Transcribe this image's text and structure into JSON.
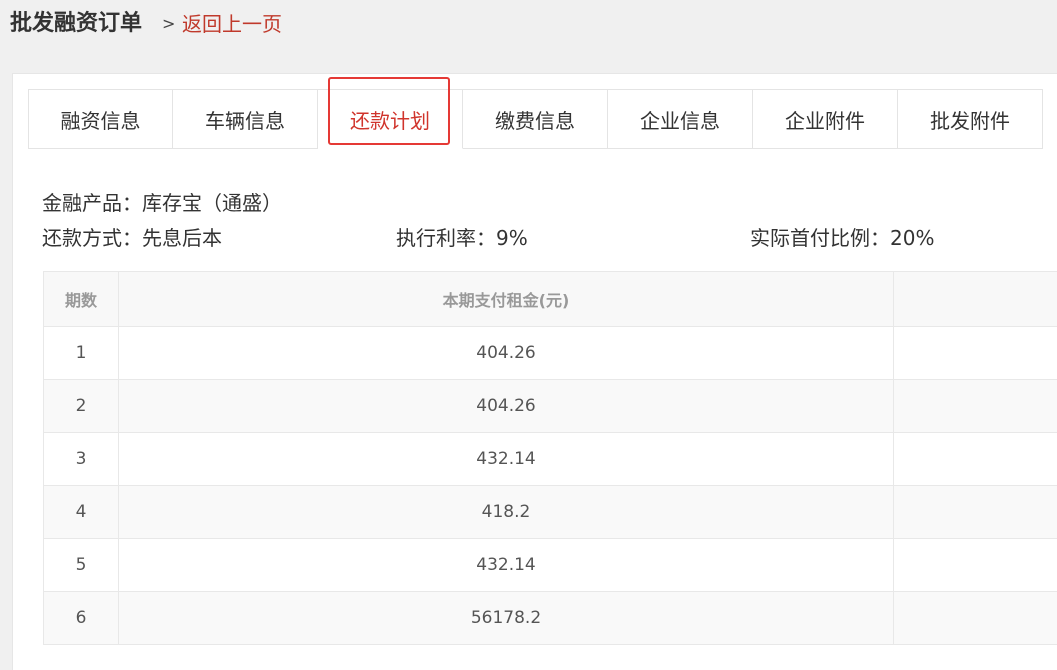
{
  "header": {
    "title": "批发融资订单",
    "separator": ">",
    "back_link": "返回上一页"
  },
  "tabs": [
    {
      "label": "融资信息",
      "active": false
    },
    {
      "label": "车辆信息",
      "active": false
    },
    {
      "label": "还款计划",
      "active": true
    },
    {
      "label": "缴费信息",
      "active": false
    },
    {
      "label": "企业信息",
      "active": false
    },
    {
      "label": "企业附件",
      "active": false
    },
    {
      "label": "批发附件",
      "active": false
    }
  ],
  "info": {
    "product": "金融产品：库存宝（通盛）",
    "repayment_method": "还款方式：先息后本",
    "interest_rate": "执行利率：9%",
    "down_payment_ratio": "实际首付比例：20%"
  },
  "table": {
    "columns": [
      "期数",
      "本期支付租金(元)",
      ""
    ],
    "rows": [
      {
        "period": "1",
        "amount": "404.26"
      },
      {
        "period": "2",
        "amount": "404.26"
      },
      {
        "period": "3",
        "amount": "432.14"
      },
      {
        "period": "4",
        "amount": "418.2"
      },
      {
        "period": "5",
        "amount": "432.14"
      },
      {
        "period": "6",
        "amount": "56178.2"
      }
    ]
  },
  "colors": {
    "accent": "#d0342c",
    "highlight_outline": "#e53935"
  }
}
